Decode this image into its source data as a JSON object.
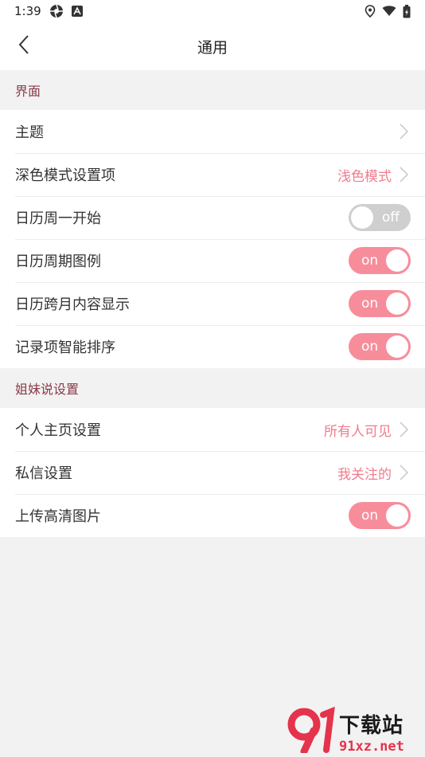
{
  "status": {
    "time": "1:39"
  },
  "header": {
    "title": "通用"
  },
  "sections": [
    {
      "title": "界面",
      "rows": [
        {
          "label": "主题",
          "kind": "nav",
          "value": ""
        },
        {
          "label": "深色模式设置项",
          "kind": "nav",
          "value": "浅色模式"
        },
        {
          "label": "日历周一开始",
          "kind": "toggle",
          "state": "off",
          "toggle_text": "off"
        },
        {
          "label": "日历周期图例",
          "kind": "toggle",
          "state": "on",
          "toggle_text": "on"
        },
        {
          "label": "日历跨月内容显示",
          "kind": "toggle",
          "state": "on",
          "toggle_text": "on"
        },
        {
          "label": "记录项智能排序",
          "kind": "toggle",
          "state": "on",
          "toggle_text": "on"
        }
      ]
    },
    {
      "title": "姐妹说设置",
      "rows": [
        {
          "label": "个人主页设置",
          "kind": "nav",
          "value": "所有人可见"
        },
        {
          "label": "私信设置",
          "kind": "nav",
          "value": "我关注的"
        },
        {
          "label": "上传高清图片",
          "kind": "toggle",
          "state": "on",
          "toggle_text": "on"
        }
      ]
    }
  ],
  "watermark": {
    "line1": "下载站",
    "line2": "91xz.net"
  },
  "colors": {
    "accent": "#f78d9b",
    "value_text": "#f07c8c",
    "section_text": "#8a3a4a",
    "toggle_off": "#cfcfcf"
  }
}
